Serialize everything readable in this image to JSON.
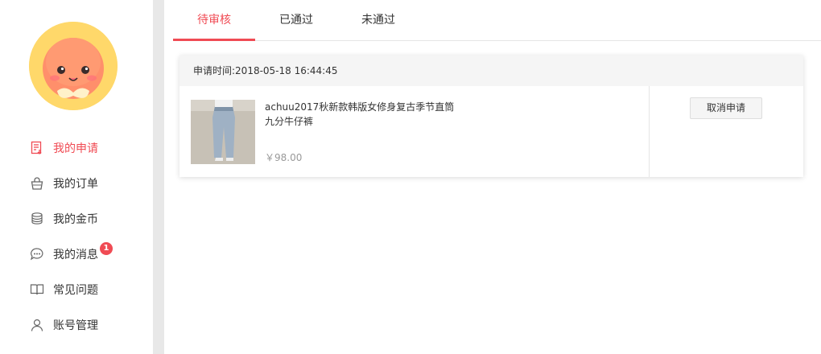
{
  "sidebar": {
    "items": [
      {
        "label": "我的申请",
        "icon": "apply-list-icon",
        "active": true
      },
      {
        "label": "我的订单",
        "icon": "shopping-bag-icon"
      },
      {
        "label": "我的金币",
        "icon": "coin-stack-icon"
      },
      {
        "label": "我的消息",
        "icon": "chat-bubble-icon",
        "badge": "1"
      },
      {
        "label": "常见问题",
        "icon": "open-book-icon"
      },
      {
        "label": "账号管理",
        "icon": "user-icon"
      }
    ]
  },
  "tabs": [
    {
      "label": "待审核",
      "active": true
    },
    {
      "label": "已通过"
    },
    {
      "label": "未通过"
    }
  ],
  "application": {
    "time_label": "申请时间:2018-05-18 16:44:45",
    "product_title_line1": "achuu2017秋新款韩版女修身复古季节直筒",
    "product_title_line2": "九分牛仔裤",
    "price": "￥98.00",
    "cancel_label": "取消申请"
  },
  "colors": {
    "accent": "#f04b54",
    "avatar_bg": "#ffd86a"
  }
}
